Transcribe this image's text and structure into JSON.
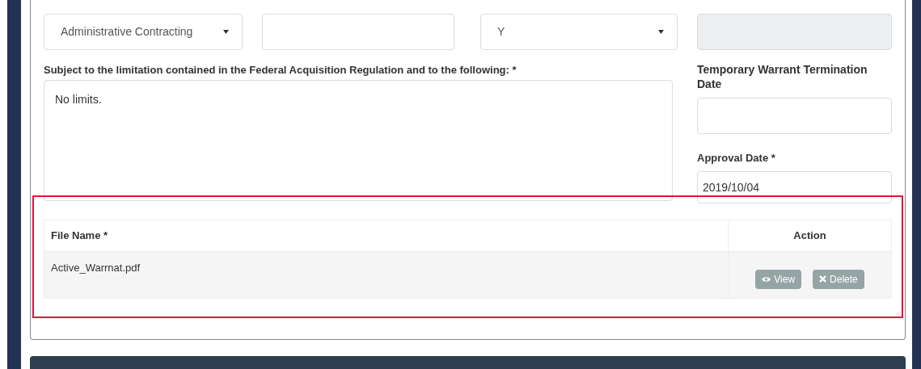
{
  "top_fields": [
    {
      "kind": "select",
      "value": "Administrative Contracting"
    },
    {
      "kind": "input"
    },
    {
      "kind": "select",
      "value": "Y"
    },
    {
      "kind": "input",
      "disabled": true
    }
  ],
  "limitation": {
    "label": "Subject to the limitation contained in the Federal Acquisition Regulation and to the following: *",
    "value": "No limits."
  },
  "termination_date": {
    "label": "Temporary Warrant Termination Date"
  },
  "approval_date": {
    "label": "Approval Date *",
    "value": "2019/10/04"
  },
  "files": {
    "columns": [
      "File Name *",
      "Action"
    ],
    "rows": [
      {
        "name": "Active_Warrnat.pdf",
        "actions": [
          {
            "kind": "view",
            "label": "View"
          },
          {
            "kind": "delete",
            "label": "Delete"
          }
        ]
      }
    ]
  },
  "highlight": {
    "color": "#e0143c"
  }
}
